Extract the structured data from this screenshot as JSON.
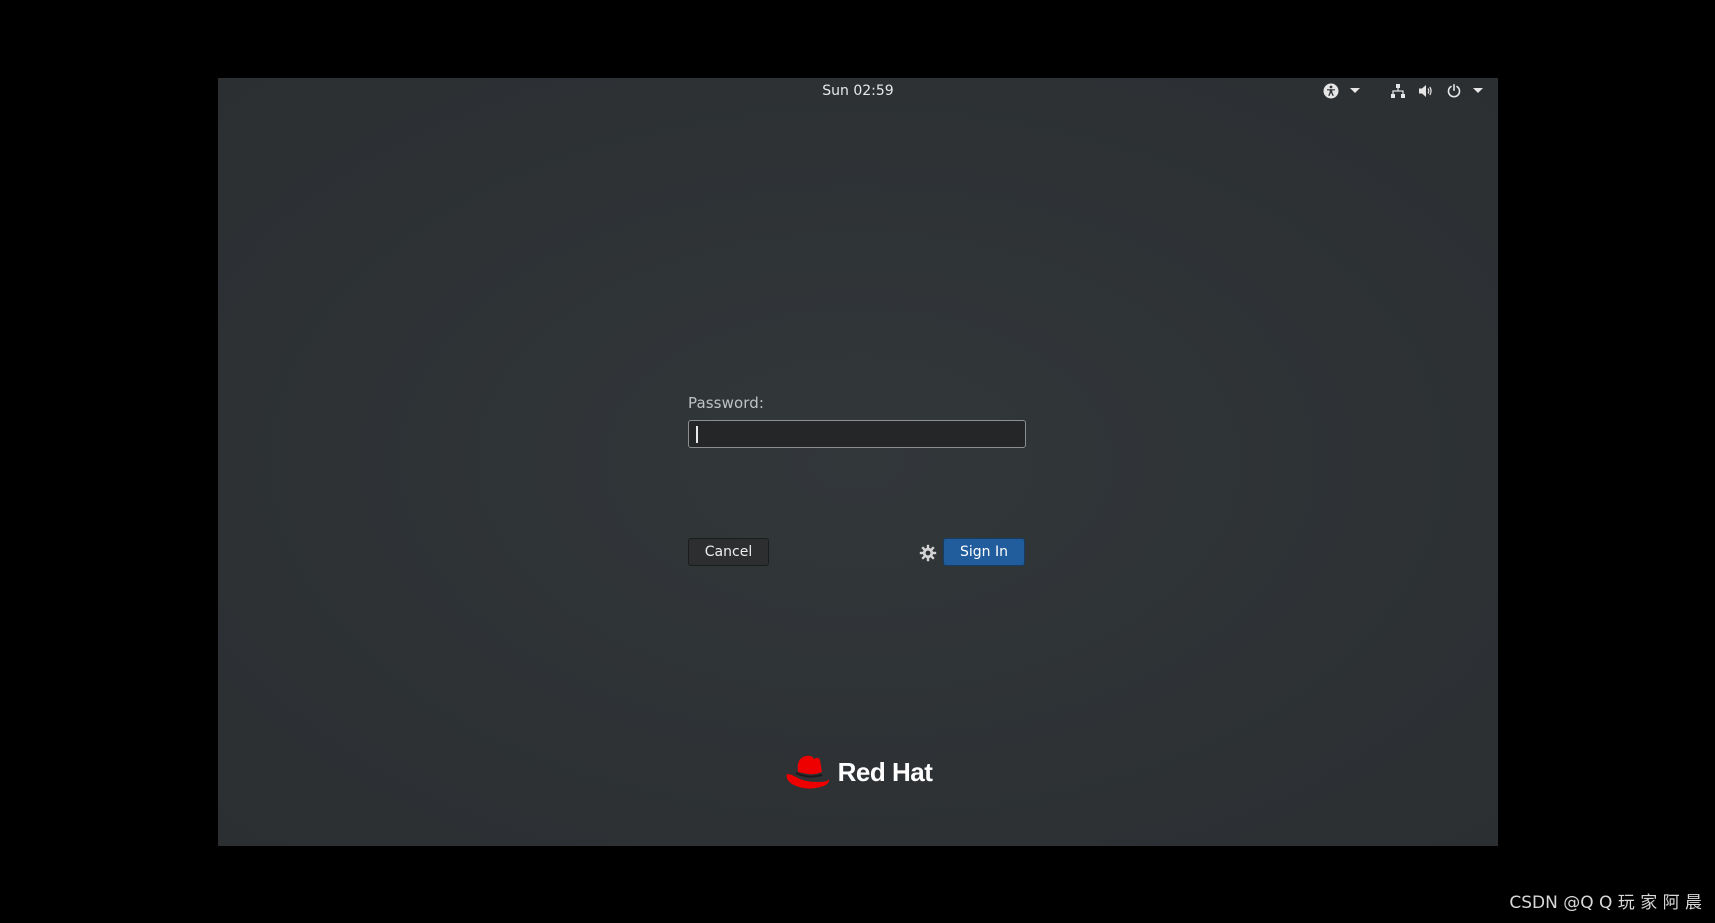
{
  "topbar": {
    "clock": "Sun 02:59",
    "icons": [
      "accessibility-icon",
      "chevron-down-icon",
      "network-wired-icon",
      "volume-icon",
      "power-icon",
      "chevron-down-icon"
    ]
  },
  "login": {
    "password_label": "Password:",
    "password_value": ""
  },
  "buttons": {
    "cancel_label": "Cancel",
    "signin_label": "Sign In",
    "session_icon": "gear-icon"
  },
  "brand": {
    "name": "Red Hat",
    "logo_icon": "red-hat-logo-icon",
    "logo_color": "#ee0000"
  },
  "watermark": "CSDN @Q Q 玩 家 阿 晨",
  "colors": {
    "background": "#2e3235",
    "outer": "#000000",
    "signin_button": "#215d9c",
    "cancel_button": "#2c2e30"
  }
}
